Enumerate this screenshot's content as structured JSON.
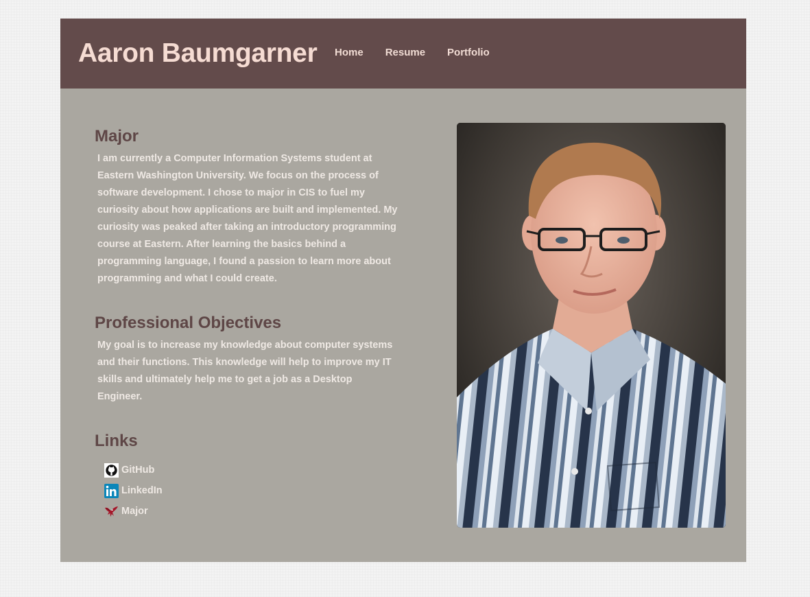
{
  "header": {
    "title": "Aaron Baumgarner",
    "nav": [
      "Home",
      "Resume",
      "Portfolio"
    ]
  },
  "sections": {
    "major": {
      "heading": "Major",
      "text": "I am currently a Computer Information Systems student at Eastern Washington University. We focus on the process of software development. I chose to major in CIS to fuel my curiosity about how applications are built and implemented. My curiosity was peaked after taking an introductory programming course at Eastern. After learning the basics behind a programming language, I found a passion to learn more about programming and what I could create."
    },
    "objectives": {
      "heading": "Professional Objectives",
      "text": "My goal is to increase my knowledge about computer systems and their functions. This knowledge will help to improve my IT skills and ultimately help me to get a job as a Desktop Engineer."
    },
    "links": {
      "heading": "Links",
      "items": [
        {
          "label": "GitHub",
          "icon": "github-icon"
        },
        {
          "label": "LinkedIn",
          "icon": "linkedin-icon"
        },
        {
          "label": "Major",
          "icon": "eagle-icon"
        }
      ]
    }
  },
  "photo": {
    "icon": "profile-photo"
  },
  "colors": {
    "header_bg": "#634b4b",
    "content_bg": "#aaa7a0",
    "title": "#f6dcd3",
    "heading": "#5e4646",
    "body_text": "#efe9e4"
  }
}
